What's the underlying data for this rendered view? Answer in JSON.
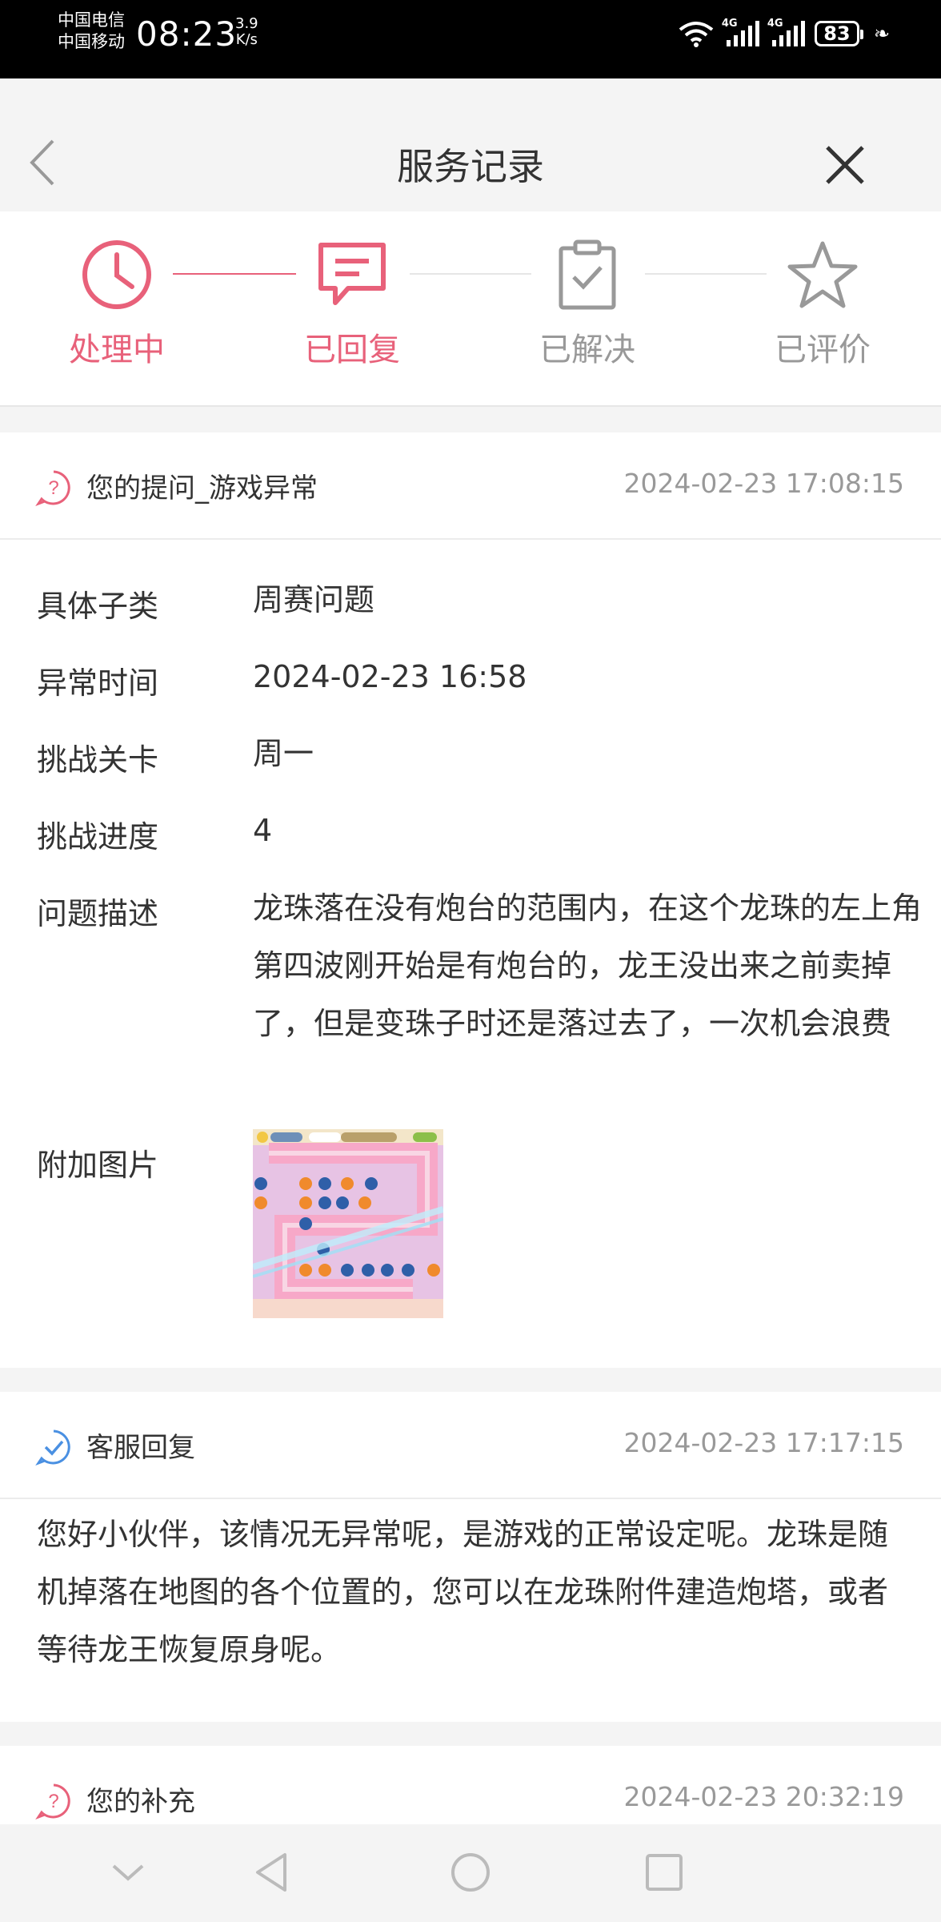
{
  "status_bar": {
    "carrier_1": "中国电信",
    "carrier_2": "中国移动",
    "time": "08:23",
    "speed_value": "3.9",
    "speed_unit": "K/s",
    "network_1": "4G",
    "network_2": "4G",
    "battery": "83"
  },
  "header": {
    "title": "服务记录"
  },
  "steps": [
    {
      "label": "处理中",
      "state": "active",
      "icon": "clock-icon"
    },
    {
      "label": "已回复",
      "state": "active",
      "icon": "chat-bubble-icon"
    },
    {
      "label": "已解决",
      "state": "inactive",
      "icon": "clipboard-check-icon"
    },
    {
      "label": "已评价",
      "state": "inactive",
      "icon": "star-icon"
    }
  ],
  "colors": {
    "accent": "#e8617a",
    "inactive": "#999999",
    "reply_icon": "#4a90e2"
  },
  "question": {
    "title": "您的提问_游戏异常",
    "time": "2024-02-23 17:08:15",
    "fields": [
      {
        "key": "具体子类",
        "value": "周赛问题"
      },
      {
        "key": "异常时间",
        "value": "2024-02-23 16:58"
      },
      {
        "key": "挑战关卡",
        "value": "周一"
      },
      {
        "key": "挑战进度",
        "value": "4"
      },
      {
        "key": "问题描述",
        "value": "龙珠落在没有炮台的范围内，在这个龙珠的左上角第四波刚开始是有炮台的，龙王没出来之前卖掉了，但是变珠子时还是落过去了，一次机会浪费"
      },
      {
        "key": "附加图片",
        "value": ""
      }
    ]
  },
  "reply": {
    "title": "客服回复",
    "time": "2024-02-23 17:17:15",
    "text": "您好小伙伴，该情况无异常呢，是游戏的正常设定呢。龙珠是随机掉落在地图的各个位置的，您可以在龙珠附件建造炮塔，或者等待龙王恢复原身呢。"
  },
  "supplement": {
    "title": "您的补充",
    "time": "2024-02-23 20:32:19"
  }
}
